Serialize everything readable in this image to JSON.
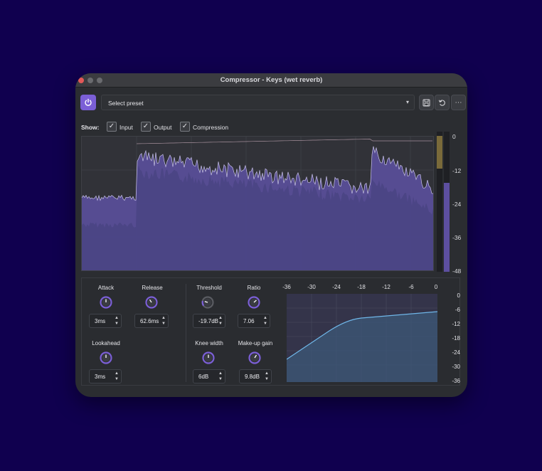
{
  "window": {
    "title": "Compressor - Keys (wet reverb)"
  },
  "toolbar": {
    "power_icon": "power-icon",
    "preset_label": "Select preset",
    "caret": "▾",
    "save_icon": "save-icon",
    "reset_icon": "undo-icon",
    "more_icon": "more-icon",
    "more_glyph": "⋯"
  },
  "show": {
    "label": "Show:",
    "options": [
      {
        "label": "Input",
        "checked": true
      },
      {
        "label": "Output",
        "checked": true
      },
      {
        "label": "Compression",
        "checked": true
      }
    ]
  },
  "meter": {
    "scale": [
      "0",
      "-12",
      "-24",
      "-36",
      "-48"
    ]
  },
  "controls": {
    "attack": {
      "label": "Attack",
      "value": "3ms"
    },
    "release": {
      "label": "Release",
      "value": "62.6ms"
    },
    "lookahead": {
      "label": "Lookahead",
      "value": "3ms"
    },
    "threshold": {
      "label": "Threshold",
      "value": "-19.7dB"
    },
    "ratio": {
      "label": "Ratio",
      "value": "7.06"
    },
    "knee": {
      "label": "Knee width",
      "value": "6dB"
    },
    "makeup": {
      "label": "Make-up gain",
      "value": "9.8dB"
    }
  },
  "curve": {
    "x_ticks": [
      "-36",
      "-30",
      "-24",
      "-18",
      "-12",
      "-6",
      "0"
    ],
    "y_ticks": [
      "0",
      "-6",
      "-12",
      "-18",
      "-24",
      "-30",
      "-36"
    ]
  },
  "colors": {
    "accent": "#7b5fd6",
    "input_fill": "#5e4fa0",
    "curve": "#6fb6e8"
  }
}
